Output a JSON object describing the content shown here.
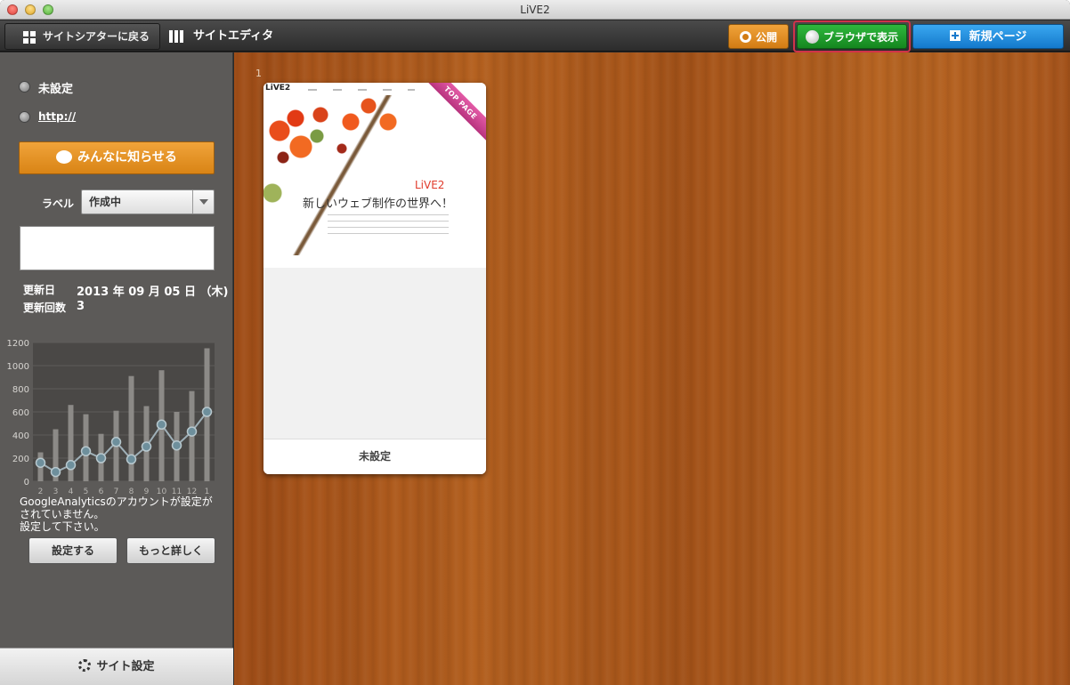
{
  "window": {
    "title": "LiVE2"
  },
  "toolbar": {
    "back_label": "サイトシアターに戻る",
    "editor_label": "サイトエディタ",
    "publish_label": "公開",
    "browser_label": "ブラウザで表示",
    "newpage_label": "新規ページ"
  },
  "sidebar": {
    "site_name": "未設定",
    "site_url": "http://",
    "notify_label": "みんなに知らせる",
    "label_caption": "ラベル",
    "label_value": "作成中",
    "updated_caption": "更新日",
    "updated_value": "2013 年 09 月 05 日 （木)",
    "count_caption": "更新回数",
    "count_value": "3",
    "ga_message_line1": "GoogleAnalyticsのアカウントが設定が",
    "ga_message_line2": "されていません。",
    "ga_message_line3": "設定して下さい。",
    "setup_label": "設定する",
    "more_label": "もっと詳しく",
    "site_settings_label": "サイト設定"
  },
  "chart_data": {
    "type": "bar",
    "categories": [
      "2",
      "3",
      "4",
      "5",
      "6",
      "7",
      "8",
      "9",
      "10",
      "11",
      "12",
      "1"
    ],
    "yticks": [
      "1200",
      "1000",
      "800",
      "600",
      "400",
      "200",
      "0"
    ],
    "ylim": [
      0,
      1200
    ],
    "series": [
      {
        "values": [
          250,
          450,
          660,
          580,
          410,
          610,
          910,
          650,
          960,
          600,
          780,
          1150
        ]
      },
      {
        "values": [
          160,
          80,
          140,
          260,
          200,
          340,
          190,
          300,
          490,
          310,
          430,
          600
        ]
      }
    ]
  },
  "page_card": {
    "number": "1",
    "badge": "TOP PAGE",
    "logo": "LiVE2",
    "brand": "LiVE2",
    "headline": "新しいウェブ制作の世界へ！",
    "name": "未設定"
  },
  "colors": {
    "publish": "#e08a1e",
    "browser": "#1c9a2a",
    "newpage": "#1a8ee0",
    "highlight": "#d0324a"
  }
}
